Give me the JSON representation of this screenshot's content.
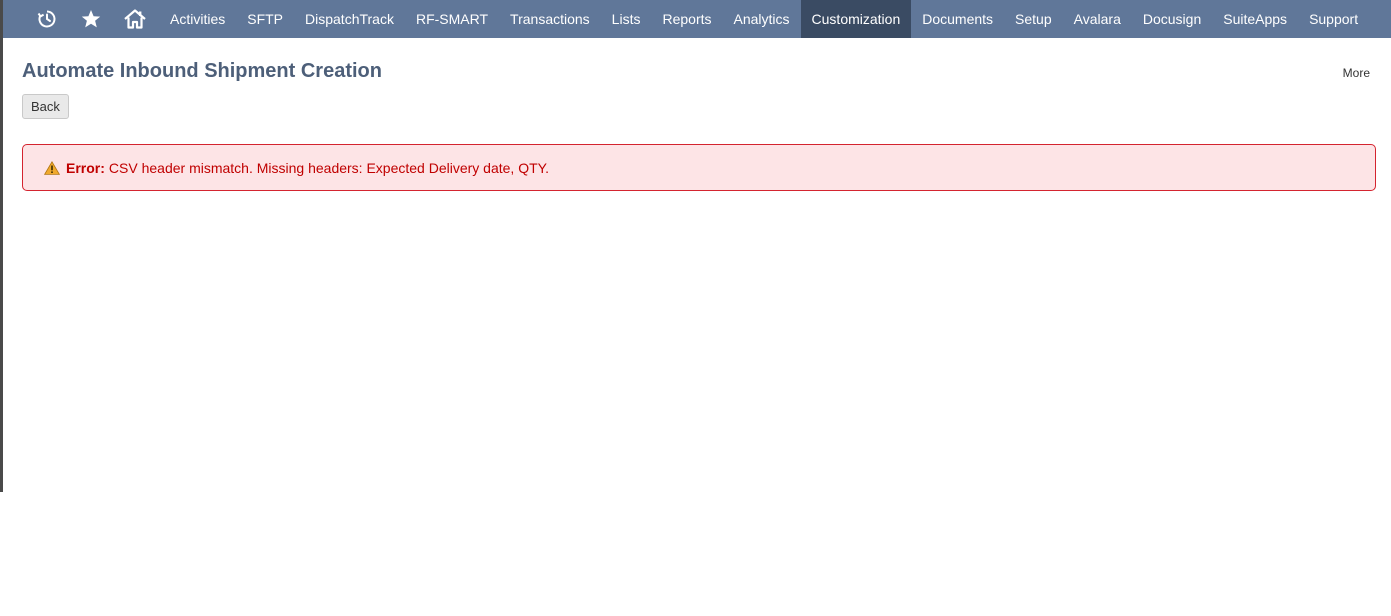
{
  "navbar": {
    "icons": [
      {
        "name": "recent-history-icon"
      },
      {
        "name": "star-icon"
      },
      {
        "name": "home-icon"
      }
    ],
    "items": [
      {
        "label": "Activities"
      },
      {
        "label": "SFTP"
      },
      {
        "label": "DispatchTrack"
      },
      {
        "label": "RF-SMART"
      },
      {
        "label": "Transactions"
      },
      {
        "label": "Lists"
      },
      {
        "label": "Reports"
      },
      {
        "label": "Analytics"
      },
      {
        "label": "Customization",
        "active": true
      },
      {
        "label": "Documents"
      },
      {
        "label": "Setup"
      },
      {
        "label": "Avalara"
      },
      {
        "label": "Docusign"
      },
      {
        "label": "SuiteApps"
      },
      {
        "label": "Support"
      }
    ]
  },
  "page": {
    "title": "Automate Inbound Shipment Creation",
    "more_label": "More",
    "back_label": "Back"
  },
  "error": {
    "icon": "warning-icon",
    "label": "Error:",
    "message": "CSV header mismatch. Missing headers: Expected Delivery date, QTY."
  },
  "colors": {
    "navbar_bg": "#607799",
    "navbar_active_bg": "#3a4b63",
    "title_color": "#4d5f79",
    "error_bg": "#fde4e6",
    "error_border": "#d4242f",
    "error_text": "#c00000"
  }
}
